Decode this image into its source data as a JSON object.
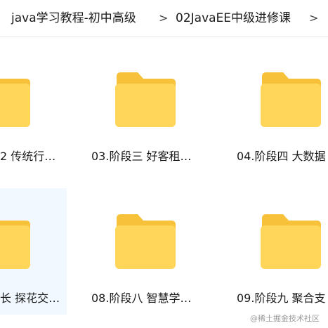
{
  "breadcrumb": {
    "items": [
      "java学习教程-初中高级",
      "02JavaEE中级进修课"
    ],
    "separator": ">"
  },
  "folders": [
    {
      "label": "2 传统行…"
    },
    {
      "label": "03.阶段三 好客租…"
    },
    {
      "label": "04.阶段四 大数据"
    },
    {
      "label": "长 探花交…"
    },
    {
      "label": "08.阶段八 智慧学…"
    },
    {
      "label": "09.阶段九 聚合支"
    }
  ],
  "watermark": "@稀土掘金技术社区",
  "colors": {
    "folder_front": "#ffd65a",
    "folder_back": "#f7c23a",
    "selection": "#f1f8ff"
  }
}
